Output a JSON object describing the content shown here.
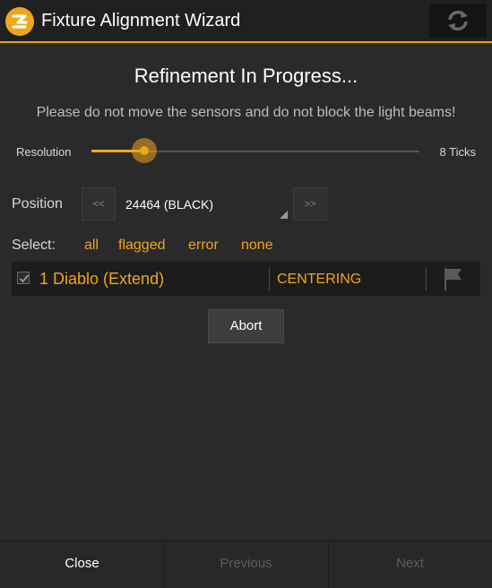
{
  "window": {
    "title": "Fixture Alignment Wizard",
    "logo_icon": "app-logo-icon",
    "refresh_icon": "refresh-icon"
  },
  "main": {
    "heading": "Refinement In Progress...",
    "warning": "Please do not move the sensors and do not block the light beams!"
  },
  "resolution": {
    "label": "Resolution",
    "value_label": "8 Ticks",
    "slider_fraction": 0.16
  },
  "position": {
    "label": "Position",
    "prev_label": "<<",
    "next_label": ">>",
    "selected": "24464 (BLACK)"
  },
  "select": {
    "label": "Select:",
    "options": [
      "all",
      "flagged",
      "error",
      "none"
    ]
  },
  "fixtures": [
    {
      "checked": true,
      "name": "1 Diablo (Extend)",
      "status": "CENTERING",
      "flag_icon": "flag-icon"
    }
  ],
  "actions": {
    "abort": "Abort"
  },
  "footer": {
    "close": "Close",
    "previous": "Previous",
    "next": "Next"
  },
  "colors": {
    "accent": "#f0a61a",
    "background": "#2a2a2a",
    "titlebar": "#202020",
    "disabled_text": "#5e5e5e"
  }
}
